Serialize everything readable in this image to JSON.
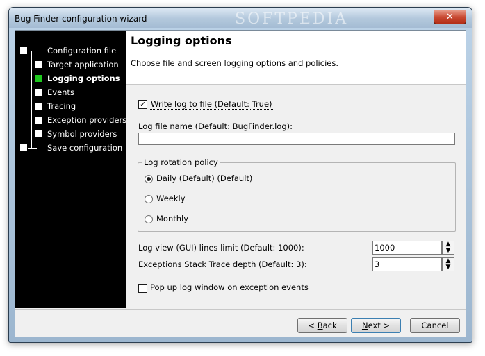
{
  "window": {
    "title": "Bug Finder configuration wizard",
    "close_glyph": "✕",
    "watermark": "SOFTPEDIA"
  },
  "steps": [
    {
      "label": "Configuration file",
      "active": false
    },
    {
      "label": "Target application",
      "active": false
    },
    {
      "label": "Logging options",
      "active": true
    },
    {
      "label": "Events",
      "active": false
    },
    {
      "label": "Tracing",
      "active": false
    },
    {
      "label": "Exception providers",
      "active": false
    },
    {
      "label": "Symbol providers",
      "active": false
    },
    {
      "label": "Save configuration",
      "active": false
    }
  ],
  "header": {
    "title": "Logging options",
    "subtitle": "Choose file and screen logging options and policies."
  },
  "options": {
    "write_log": {
      "label": "Write log to file (Default: True)",
      "checked": true,
      "check_glyph": "✓"
    },
    "log_file_name": {
      "label": "Log file name (Default: BugFinder.log):",
      "value": ""
    },
    "rotation": {
      "legend": "Log rotation policy",
      "choices": [
        {
          "label": "Daily (Default) (Default)",
          "selected": true
        },
        {
          "label": "Weekly",
          "selected": false
        },
        {
          "label": "Monthly",
          "selected": false
        }
      ]
    },
    "gui_lines": {
      "label": "Log view (GUI) lines limit (Default: 1000):",
      "value": "1000"
    },
    "stack_depth": {
      "label": "Exceptions Stack Trace depth (Default: 3):",
      "value": "3"
    },
    "popup": {
      "label": "Pop up log window on exception events",
      "checked": false
    }
  },
  "spin_arrows": {
    "up": "▲",
    "down": "▼"
  },
  "buttons": {
    "back_prefix": "< ",
    "back_key": "B",
    "back_rest": "ack",
    "next_key": "N",
    "next_rest": "ext >",
    "cancel": "Cancel"
  },
  "colors": {
    "active_step": "#1ec81e",
    "sidebar_bg": "#000000"
  }
}
